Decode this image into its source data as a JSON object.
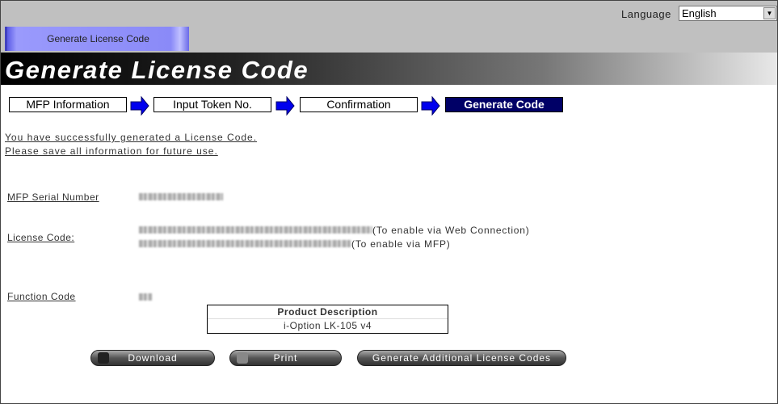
{
  "header": {
    "language_label": "Language",
    "language_value": "English",
    "tab": "Generate License Code"
  },
  "page_title": "Generate License Code",
  "steps": [
    "MFP Information",
    "Input Token No.",
    "Confirmation",
    "Generate Code"
  ],
  "messages": [
    "You have successfully generated a License Code.",
    "Please save all information for future use."
  ],
  "fields": {
    "serial_label": "MFP Serial Number",
    "license_label": "License Code:",
    "license_note_web": "(To enable via Web Connection)",
    "license_note_mfp": "(To enable via MFP)",
    "function_label": "Function Code"
  },
  "product": {
    "header": "Product Description",
    "value": "i-Option LK-105 v4"
  },
  "buttons": {
    "download": "Download",
    "print": "Print",
    "generate_more": "Generate Additional License Codes"
  },
  "colors": {
    "active_step": "#000066",
    "arrow": "#0000ee",
    "tab": "#8a8af8"
  }
}
